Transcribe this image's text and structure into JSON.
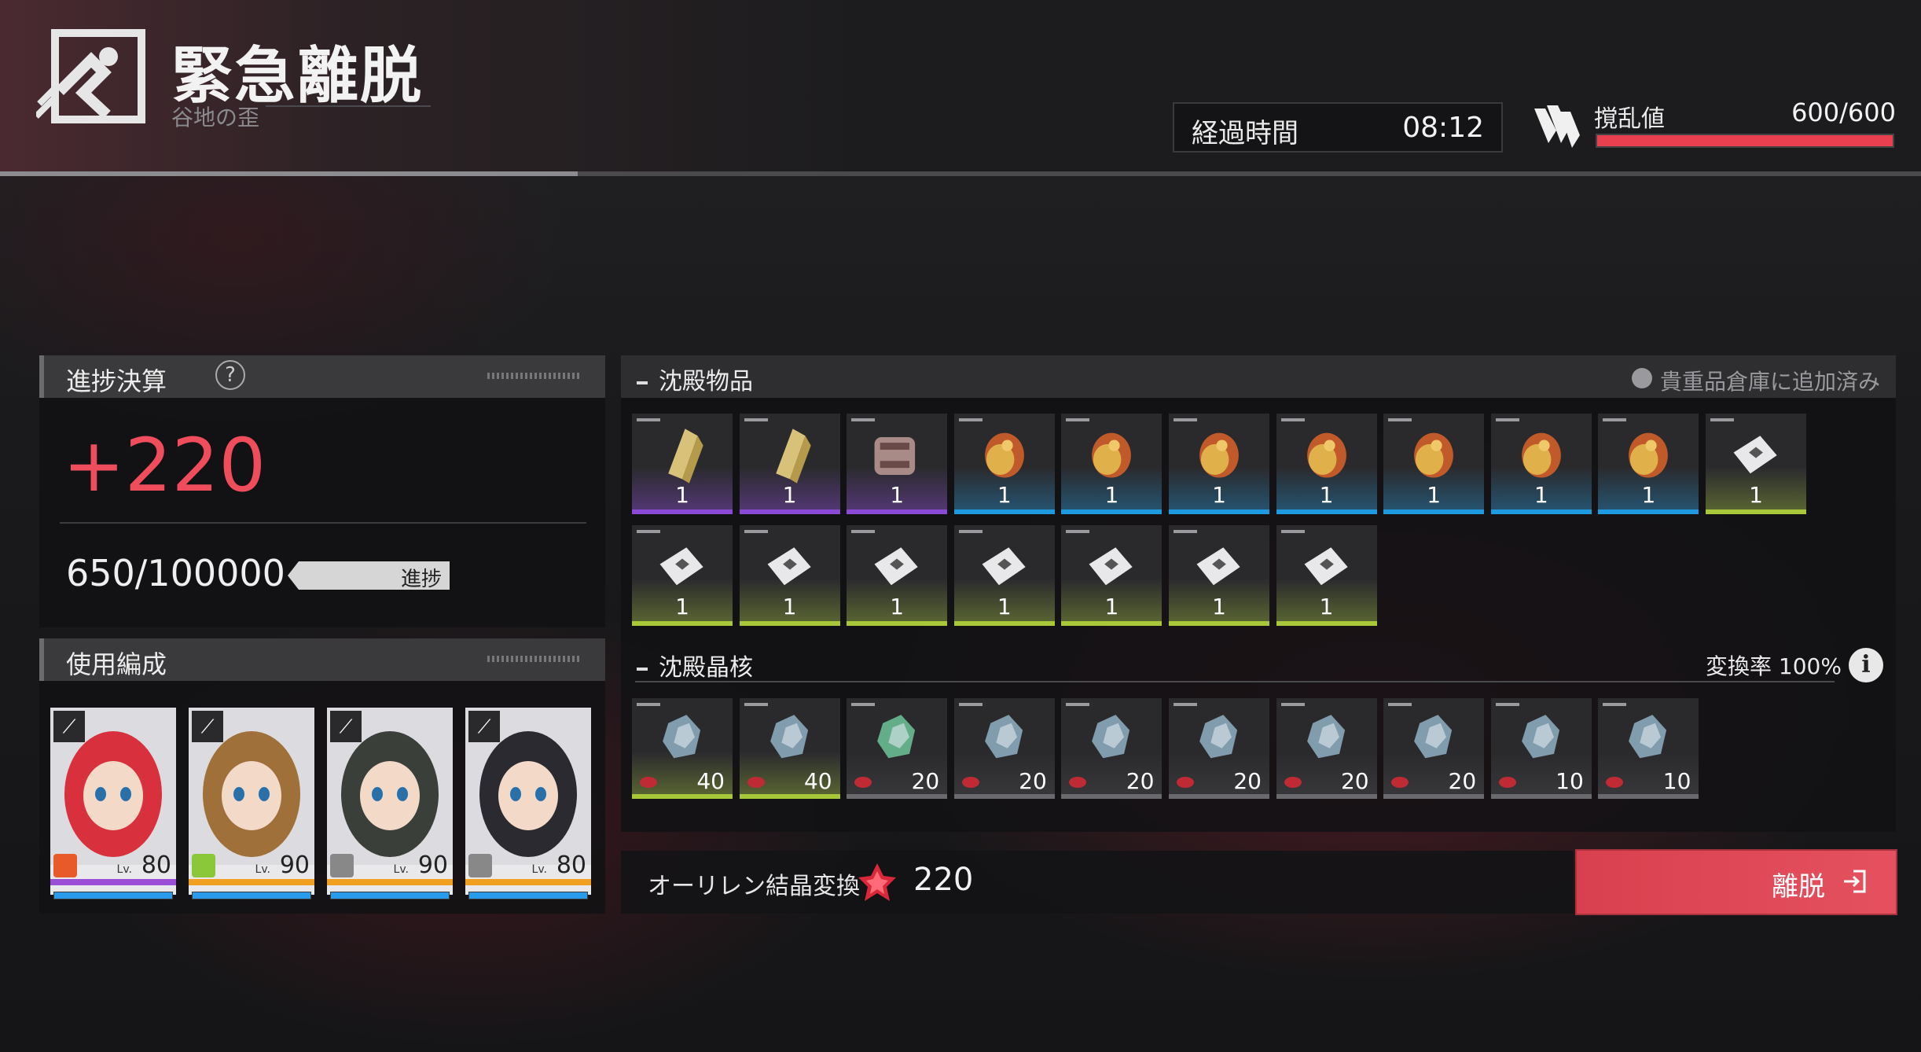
{
  "header": {
    "title": "緊急離脱",
    "subtitle": "谷地の歪",
    "time_label": "経過時間",
    "time_value": "08:12",
    "chaos_label": "撹乱値",
    "chaos_value": "600/600",
    "chaos_fill": 1.0
  },
  "progress": {
    "title": "進捗決算",
    "gain": "+220",
    "value": "650/100000",
    "button": "進捗",
    "fill": 0.0065
  },
  "team": {
    "title": "使用編成",
    "members": [
      {
        "level": "80",
        "lv": "Lv.",
        "rarity_color": "#9b4fd6",
        "elem_color": "#e85a2a"
      },
      {
        "level": "90",
        "lv": "Lv.",
        "rarity_color": "#f0a020",
        "elem_color": "#8ac83a"
      },
      {
        "level": "90",
        "lv": "Lv.",
        "rarity_color": "#f0a020",
        "elem_color": "#888888"
      },
      {
        "level": "80",
        "lv": "Lv.",
        "rarity_color": "#f0a020",
        "elem_color": "#888888"
      }
    ]
  },
  "items": {
    "title": "沈殿物品",
    "added_note": "貴重品倉庫に追加済み",
    "rows": [
      [
        {
          "count": "1",
          "tier": "purple",
          "icon": "gold-blade-icon"
        },
        {
          "count": "1",
          "tier": "purple",
          "icon": "gold-blade-icon"
        },
        {
          "count": "1",
          "tier": "purple",
          "icon": "rusty-gear-icon"
        },
        {
          "count": "1",
          "tier": "blue",
          "icon": "bronze-shell-icon"
        },
        {
          "count": "1",
          "tier": "blue",
          "icon": "bronze-shell-icon"
        },
        {
          "count": "1",
          "tier": "blue",
          "icon": "bronze-shell-icon"
        },
        {
          "count": "1",
          "tier": "blue",
          "icon": "bronze-shell-icon"
        },
        {
          "count": "1",
          "tier": "blue",
          "icon": "bronze-shell-icon"
        },
        {
          "count": "1",
          "tier": "blue",
          "icon": "bronze-shell-icon"
        },
        {
          "count": "1",
          "tier": "blue",
          "icon": "bronze-shell-icon"
        },
        {
          "count": "1",
          "tier": "green",
          "icon": "paper-icon"
        }
      ],
      [
        {
          "count": "1",
          "tier": "green",
          "icon": "paper-icon"
        },
        {
          "count": "1",
          "tier": "green",
          "icon": "paper-icon"
        },
        {
          "count": "1",
          "tier": "green",
          "icon": "paper-icon"
        },
        {
          "count": "1",
          "tier": "green",
          "icon": "paper-icon"
        },
        {
          "count": "1",
          "tier": "green",
          "icon": "paper-icon"
        },
        {
          "count": "1",
          "tier": "green",
          "icon": "paper-icon"
        },
        {
          "count": "1",
          "tier": "green",
          "icon": "paper-icon"
        }
      ]
    ]
  },
  "crystals": {
    "title": "沈殿晶核",
    "rate_label": "変換率 100%",
    "list": [
      {
        "count": "40",
        "tier": "green",
        "color": "#8fb0c4"
      },
      {
        "count": "40",
        "tier": "green",
        "color": "#8fb0c4"
      },
      {
        "count": "20",
        "tier": "gray",
        "color": "#6fc49a"
      },
      {
        "count": "20",
        "tier": "gray",
        "color": "#8fb0c4"
      },
      {
        "count": "20",
        "tier": "gray",
        "color": "#8fb0c4"
      },
      {
        "count": "20",
        "tier": "gray",
        "color": "#8fb0c4"
      },
      {
        "count": "20",
        "tier": "gray",
        "color": "#8fb0c4"
      },
      {
        "count": "20",
        "tier": "gray",
        "color": "#8fb0c4"
      },
      {
        "count": "10",
        "tier": "gray",
        "color": "#8fb0c4"
      },
      {
        "count": "10",
        "tier": "gray",
        "color": "#8fb0c4"
      }
    ]
  },
  "footer": {
    "label": "オーリレン結晶変換",
    "value": "220",
    "exit_label": "離脱"
  },
  "colors": {
    "accent": "#e8404e",
    "purple": "#8a4ad6",
    "blue": "#1e9ae0",
    "green": "#a8c83a",
    "gray": "#6a6a6e"
  }
}
